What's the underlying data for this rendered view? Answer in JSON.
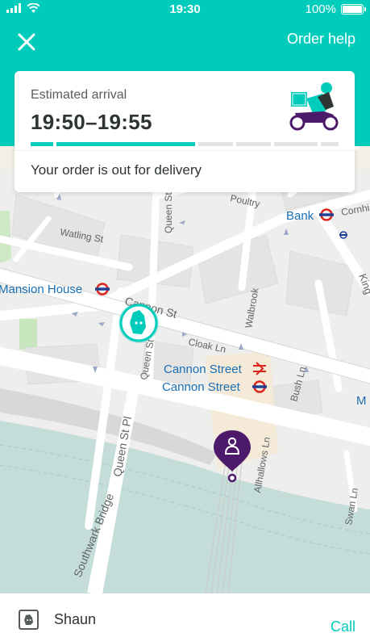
{
  "status_bar": {
    "time": "19:30",
    "battery": "100%"
  },
  "header": {
    "order_help": "Order help"
  },
  "card": {
    "label": "Estimated arrival",
    "time_range": "19:50–19:55",
    "status": "Your order is out for delivery",
    "progress": {
      "segments": 6,
      "completed": 3
    }
  },
  "map": {
    "labels": {
      "poultry": "Poultry",
      "bank": "Bank",
      "cornhill": "Cornhi",
      "watling": "Watling St",
      "queen_top": "Queen St",
      "mansion_house": "Mansion House",
      "cannon_st": "Cannon St",
      "walbrook": "Walbrook",
      "king": "King",
      "cloak": "Cloak Ln",
      "queen_st_mid": "Queen St",
      "cannon_station_1": "Cannon Street",
      "cannon_station_2": "Cannon Street",
      "bush_ln": "Bush Ln",
      "queen_st_pl": "Queen St Pl",
      "allhallows": "Allhallows Ln",
      "southwark": "Southwark Bridge",
      "swan_ln": "Swan Ln",
      "m_edge": "M"
    },
    "colors": {
      "water": "#c5ddd9",
      "teal": "#00ccbc",
      "destination": "#4d1a6b",
      "tube_red": "#dc241f",
      "tube_blue": "#1c3f94"
    }
  },
  "courier": {
    "name": "Shaun",
    "call": "Call"
  }
}
